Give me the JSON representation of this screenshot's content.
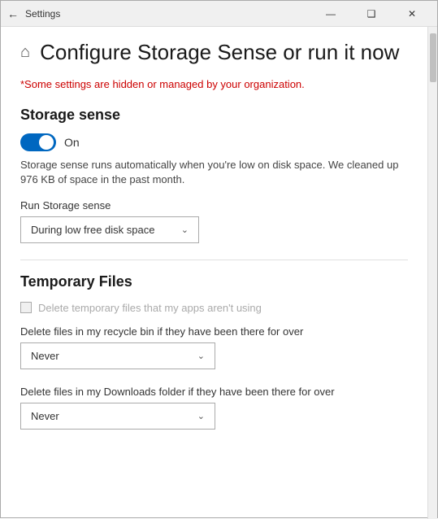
{
  "titlebar": {
    "title": "Settings",
    "back_label": "←",
    "minimize_label": "—",
    "maximize_label": "❑",
    "close_label": "✕"
  },
  "page": {
    "home_icon": "⌂",
    "title": "Configure Storage Sense or run it now",
    "org_warning": "*Some settings are hidden or managed by your organization."
  },
  "storage_sense": {
    "section_title": "Storage sense",
    "toggle_state": "On",
    "description": "Storage sense runs automatically when you're low on disk space. We cleaned up 976 KB of space in the past month.",
    "run_label": "Run Storage sense",
    "run_dropdown_value": "During low free disk space"
  },
  "temporary_files": {
    "section_title": "Temporary Files",
    "checkbox_label": "Delete temporary files that my apps aren't using",
    "recycle_label": "Delete files in my recycle bin if they have been there for over",
    "recycle_dropdown_value": "Never",
    "downloads_label": "Delete files in my Downloads folder if they have been there for over",
    "downloads_dropdown_value": "Never"
  }
}
